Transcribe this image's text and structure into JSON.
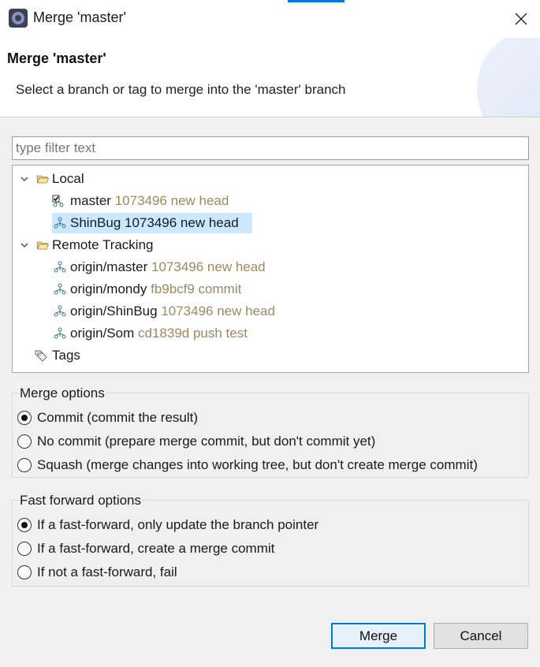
{
  "window": {
    "title": "Merge 'master'",
    "close_icon": "close-icon"
  },
  "banner": {
    "title": "Merge 'master'",
    "description": "Select a branch or tag to merge into the 'master' branch"
  },
  "filter": {
    "placeholder": "type filter text",
    "value": ""
  },
  "tree": {
    "local": {
      "label": "Local",
      "items": [
        {
          "name": "master",
          "commit": "1073496 new head",
          "icon": "checked-out-branch-icon"
        },
        {
          "name": "ShinBug",
          "commit": "1073496 new head",
          "icon": "branch-icon"
        }
      ]
    },
    "remote": {
      "label": "Remote Tracking",
      "items": [
        {
          "name": "origin/master",
          "commit": "1073496 new head"
        },
        {
          "name": "origin/mondy",
          "commit": "fb9bcf9 commit"
        },
        {
          "name": "origin/ShinBug",
          "commit": "1073496 new head"
        },
        {
          "name": "origin/Som",
          "commit": "cd1839d push test"
        }
      ]
    },
    "tags": {
      "label": "Tags"
    },
    "selection": "ShinBug"
  },
  "merge_options": {
    "title": "Merge options",
    "options": [
      {
        "label": "Commit (commit the result)",
        "checked": true
      },
      {
        "label": "No commit (prepare merge commit, but don't commit yet)",
        "checked": false
      },
      {
        "label": "Squash (merge changes into working tree, but don't create merge commit)",
        "checked": false
      }
    ]
  },
  "ff_options": {
    "title": "Fast forward options",
    "options": [
      {
        "label": "If a fast-forward, only update the branch pointer",
        "checked": true
      },
      {
        "label": "If a fast-forward, create a merge commit",
        "checked": false
      },
      {
        "label": "If not a fast-forward, fail",
        "checked": false
      }
    ]
  },
  "buttons": {
    "merge": "Merge",
    "cancel": "Cancel"
  },
  "colors": {
    "accent": "#0078d7",
    "selection": "#cce8ff",
    "commit_meta": "#9b8a5d"
  }
}
